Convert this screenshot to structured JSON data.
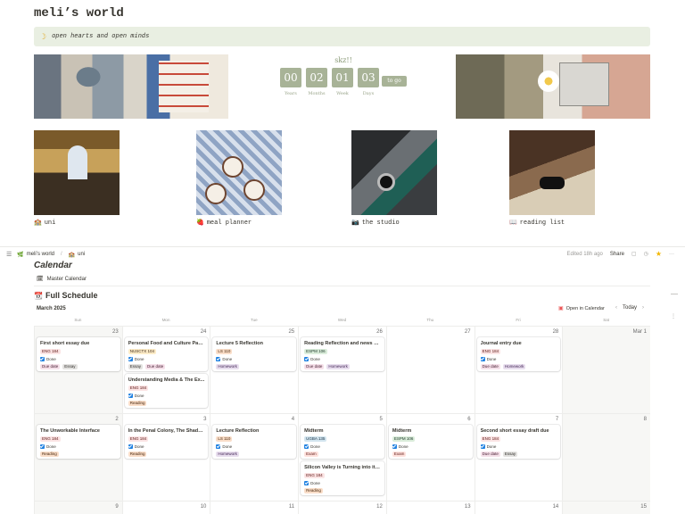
{
  "page": {
    "title": "meli’s world",
    "callout_text": "open hearts and open minds"
  },
  "countdown": {
    "title": "skz!!",
    "values": [
      "00",
      "02",
      "01",
      "03"
    ],
    "labels": [
      "Years",
      "Months",
      "Week",
      "Days"
    ],
    "suffix": "to go"
  },
  "tiles": [
    {
      "label": "uni"
    },
    {
      "label": "meal planner"
    },
    {
      "label": "the studio"
    },
    {
      "label": "reading list"
    }
  ],
  "topbar": {
    "crumb_root": "meli’s world",
    "crumb_child": "uni",
    "edited": "Edited 18h ago",
    "share": "Share"
  },
  "calendar": {
    "heading": "Calendar",
    "master": "Master Calendar",
    "full_schedule": "Full Schedule",
    "month": "March 2025",
    "open_in_calendar": "Open in Calendar",
    "today": "Today",
    "weekdays": [
      "Sun",
      "Mon",
      "Tue",
      "Wed",
      "Thu",
      "Fri",
      "Sat"
    ],
    "days": [
      [
        "23",
        "24",
        "25",
        "26",
        "27",
        "28",
        "Mar 1"
      ],
      [
        "2",
        "3",
        "4",
        "5",
        "6",
        "7",
        "8"
      ],
      [
        "9",
        "10",
        "11",
        "12",
        "13",
        "14",
        "15"
      ]
    ],
    "done_label": "Done",
    "events": [
      {
        "week": 0,
        "day": 0,
        "slot": 0,
        "title": "First short essay due",
        "course": "ENG 184",
        "tags": [
          "Due date",
          "Essay"
        ]
      },
      {
        "week": 0,
        "day": 1,
        "slot": 0,
        "title": "Personal Food and Culture Pap...",
        "course": "NUSCTX 104",
        "tags": [
          "Essay",
          "Due date"
        ]
      },
      {
        "week": 0,
        "day": 1,
        "slot": 1,
        "title": "Understanding Media & The Ex...",
        "course": "ENG 184",
        "tags": [
          "Reading"
        ]
      },
      {
        "week": 0,
        "day": 2,
        "slot": 0,
        "title": "Lecture 5 Reflection",
        "course": "LS 110",
        "tags": [
          "Homework"
        ]
      },
      {
        "week": 0,
        "day": 3,
        "slot": 0,
        "title": "Reading Reflection and news p...",
        "course": "ESPM 106",
        "tags": [
          "Due date",
          "Homework"
        ]
      },
      {
        "week": 0,
        "day": 5,
        "slot": 0,
        "title": "Journal entry due",
        "course": "ENG 184",
        "tags": [
          "Due date",
          "Homework"
        ]
      },
      {
        "week": 1,
        "day": 0,
        "slot": 0,
        "title": "The Unworkable Interface",
        "course": "ENG 184",
        "tags": [
          "Reading"
        ]
      },
      {
        "week": 1,
        "day": 1,
        "slot": 0,
        "title": "In the Penal Colony, The Shado...",
        "course": "ENG 184",
        "tags": [
          "Reading"
        ]
      },
      {
        "week": 1,
        "day": 2,
        "slot": 0,
        "title": "Lecture Reflection",
        "course": "LS 110",
        "tags": [
          "Homework"
        ]
      },
      {
        "week": 1,
        "day": 3,
        "slot": 0,
        "title": "Midterm",
        "course": "UGBA 135",
        "tags": [
          "Exam"
        ]
      },
      {
        "week": 1,
        "day": 3,
        "slot": 1,
        "title": "Silicon Valley is Turning into its...",
        "course": "ENG 184",
        "tags": [
          "Reading"
        ]
      },
      {
        "week": 1,
        "day": 4,
        "slot": 0,
        "title": "Midterm",
        "course": "ESPM 106",
        "tags": [
          "Exam"
        ]
      },
      {
        "week": 1,
        "day": 5,
        "slot": 0,
        "title": "Second short essay draft due",
        "course": "ENG 184",
        "tags": [
          "Due date",
          "Essay"
        ]
      }
    ]
  },
  "colors": {
    "course": {
      "ENG 184": "#fbe4e4",
      "NUSCTX 104": "#fdecc8",
      "LS 110": "#fadec9",
      "ESPM 106": "#dbeddb",
      "UGBA 135": "#d3e5ef"
    },
    "course_text": {
      "ENG 184": "#5d1715",
      "NUSCTX 104": "#402c1b",
      "LS 110": "#49290e",
      "ESPM 106": "#1c3829",
      "UGBA 135": "#183347"
    },
    "tag": {
      "Due date": "#f5e0e9",
      "Essay": "#e3e2e0",
      "Reading": "#fadec9",
      "Homework": "#e8deee",
      "Exam": "#ffe2dd"
    },
    "tag_text": {
      "Due date": "#4c2337",
      "Essay": "#32302c",
      "Reading": "#49290e",
      "Homework": "#412454",
      "Exam": "#5d1715"
    }
  }
}
